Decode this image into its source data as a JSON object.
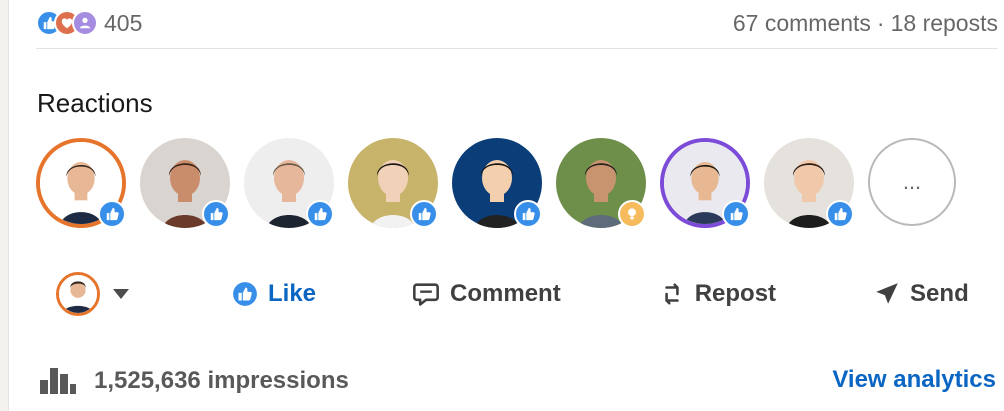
{
  "social": {
    "reaction_count": "405",
    "comments": "67 comments",
    "separator": "·",
    "reposts": "18 reposts",
    "reaction_icons": [
      "like-icon",
      "love-icon",
      "support-icon"
    ]
  },
  "reactions": {
    "title": "Reactions",
    "people": [
      {
        "name": "reactor-1",
        "ring": "orange",
        "reaction": "like",
        "skin": "#e8b896",
        "hair": "#3a2b22",
        "bg": "#ffffff",
        "shirt": "#1f2b44"
      },
      {
        "name": "reactor-2",
        "ring": "none",
        "reaction": "like",
        "skin": "#c98d6c",
        "hair": "#3a2318",
        "bg": "#d9d4cf",
        "shirt": "#6b3a2a"
      },
      {
        "name": "reactor-3",
        "ring": "none",
        "reaction": "like",
        "skin": "#e6b79a",
        "hair": "#6b5a4a",
        "bg": "#eeeeee",
        "shirt": "#1c2430"
      },
      {
        "name": "reactor-4",
        "ring": "none",
        "reaction": "like",
        "skin": "#f1d2b8",
        "hair": "#1b1511",
        "bg": "#c8b36a",
        "shirt": "#f2f2f2"
      },
      {
        "name": "reactor-5",
        "ring": "none",
        "reaction": "like",
        "skin": "#f3cfae",
        "hair": "#1a1411",
        "bg": "#0b3d78",
        "shirt": "#222222"
      },
      {
        "name": "reactor-6",
        "ring": "none",
        "reaction": "insightful",
        "skin": "#c7946f",
        "hair": "#2a211b",
        "bg": "#6e8f4a",
        "shirt": "#5d6b7a"
      },
      {
        "name": "reactor-7",
        "ring": "purple",
        "reaction": "like",
        "skin": "#e7b892",
        "hair": "#1a1410",
        "bg": "#e9e9ef",
        "shirt": "#2b3a5a"
      },
      {
        "name": "reactor-8",
        "ring": "none",
        "reaction": "like",
        "skin": "#efc9aa",
        "hair": "#2a1b14",
        "bg": "#e5e1dc",
        "shirt": "#1d1d1d"
      }
    ],
    "more_label": "..."
  },
  "actions": {
    "like": "Like",
    "comment": "Comment",
    "repost": "Repost",
    "send": "Send"
  },
  "footer": {
    "impressions": "1,525,636 impressions",
    "view_analytics": "View analytics"
  },
  "colors": {
    "accent": "#0a66c2",
    "like": "#378fe9",
    "love": "#df704d",
    "support": "#a58ce0",
    "insightful": "#f5bb5c",
    "ring_orange": "#e7742b"
  }
}
